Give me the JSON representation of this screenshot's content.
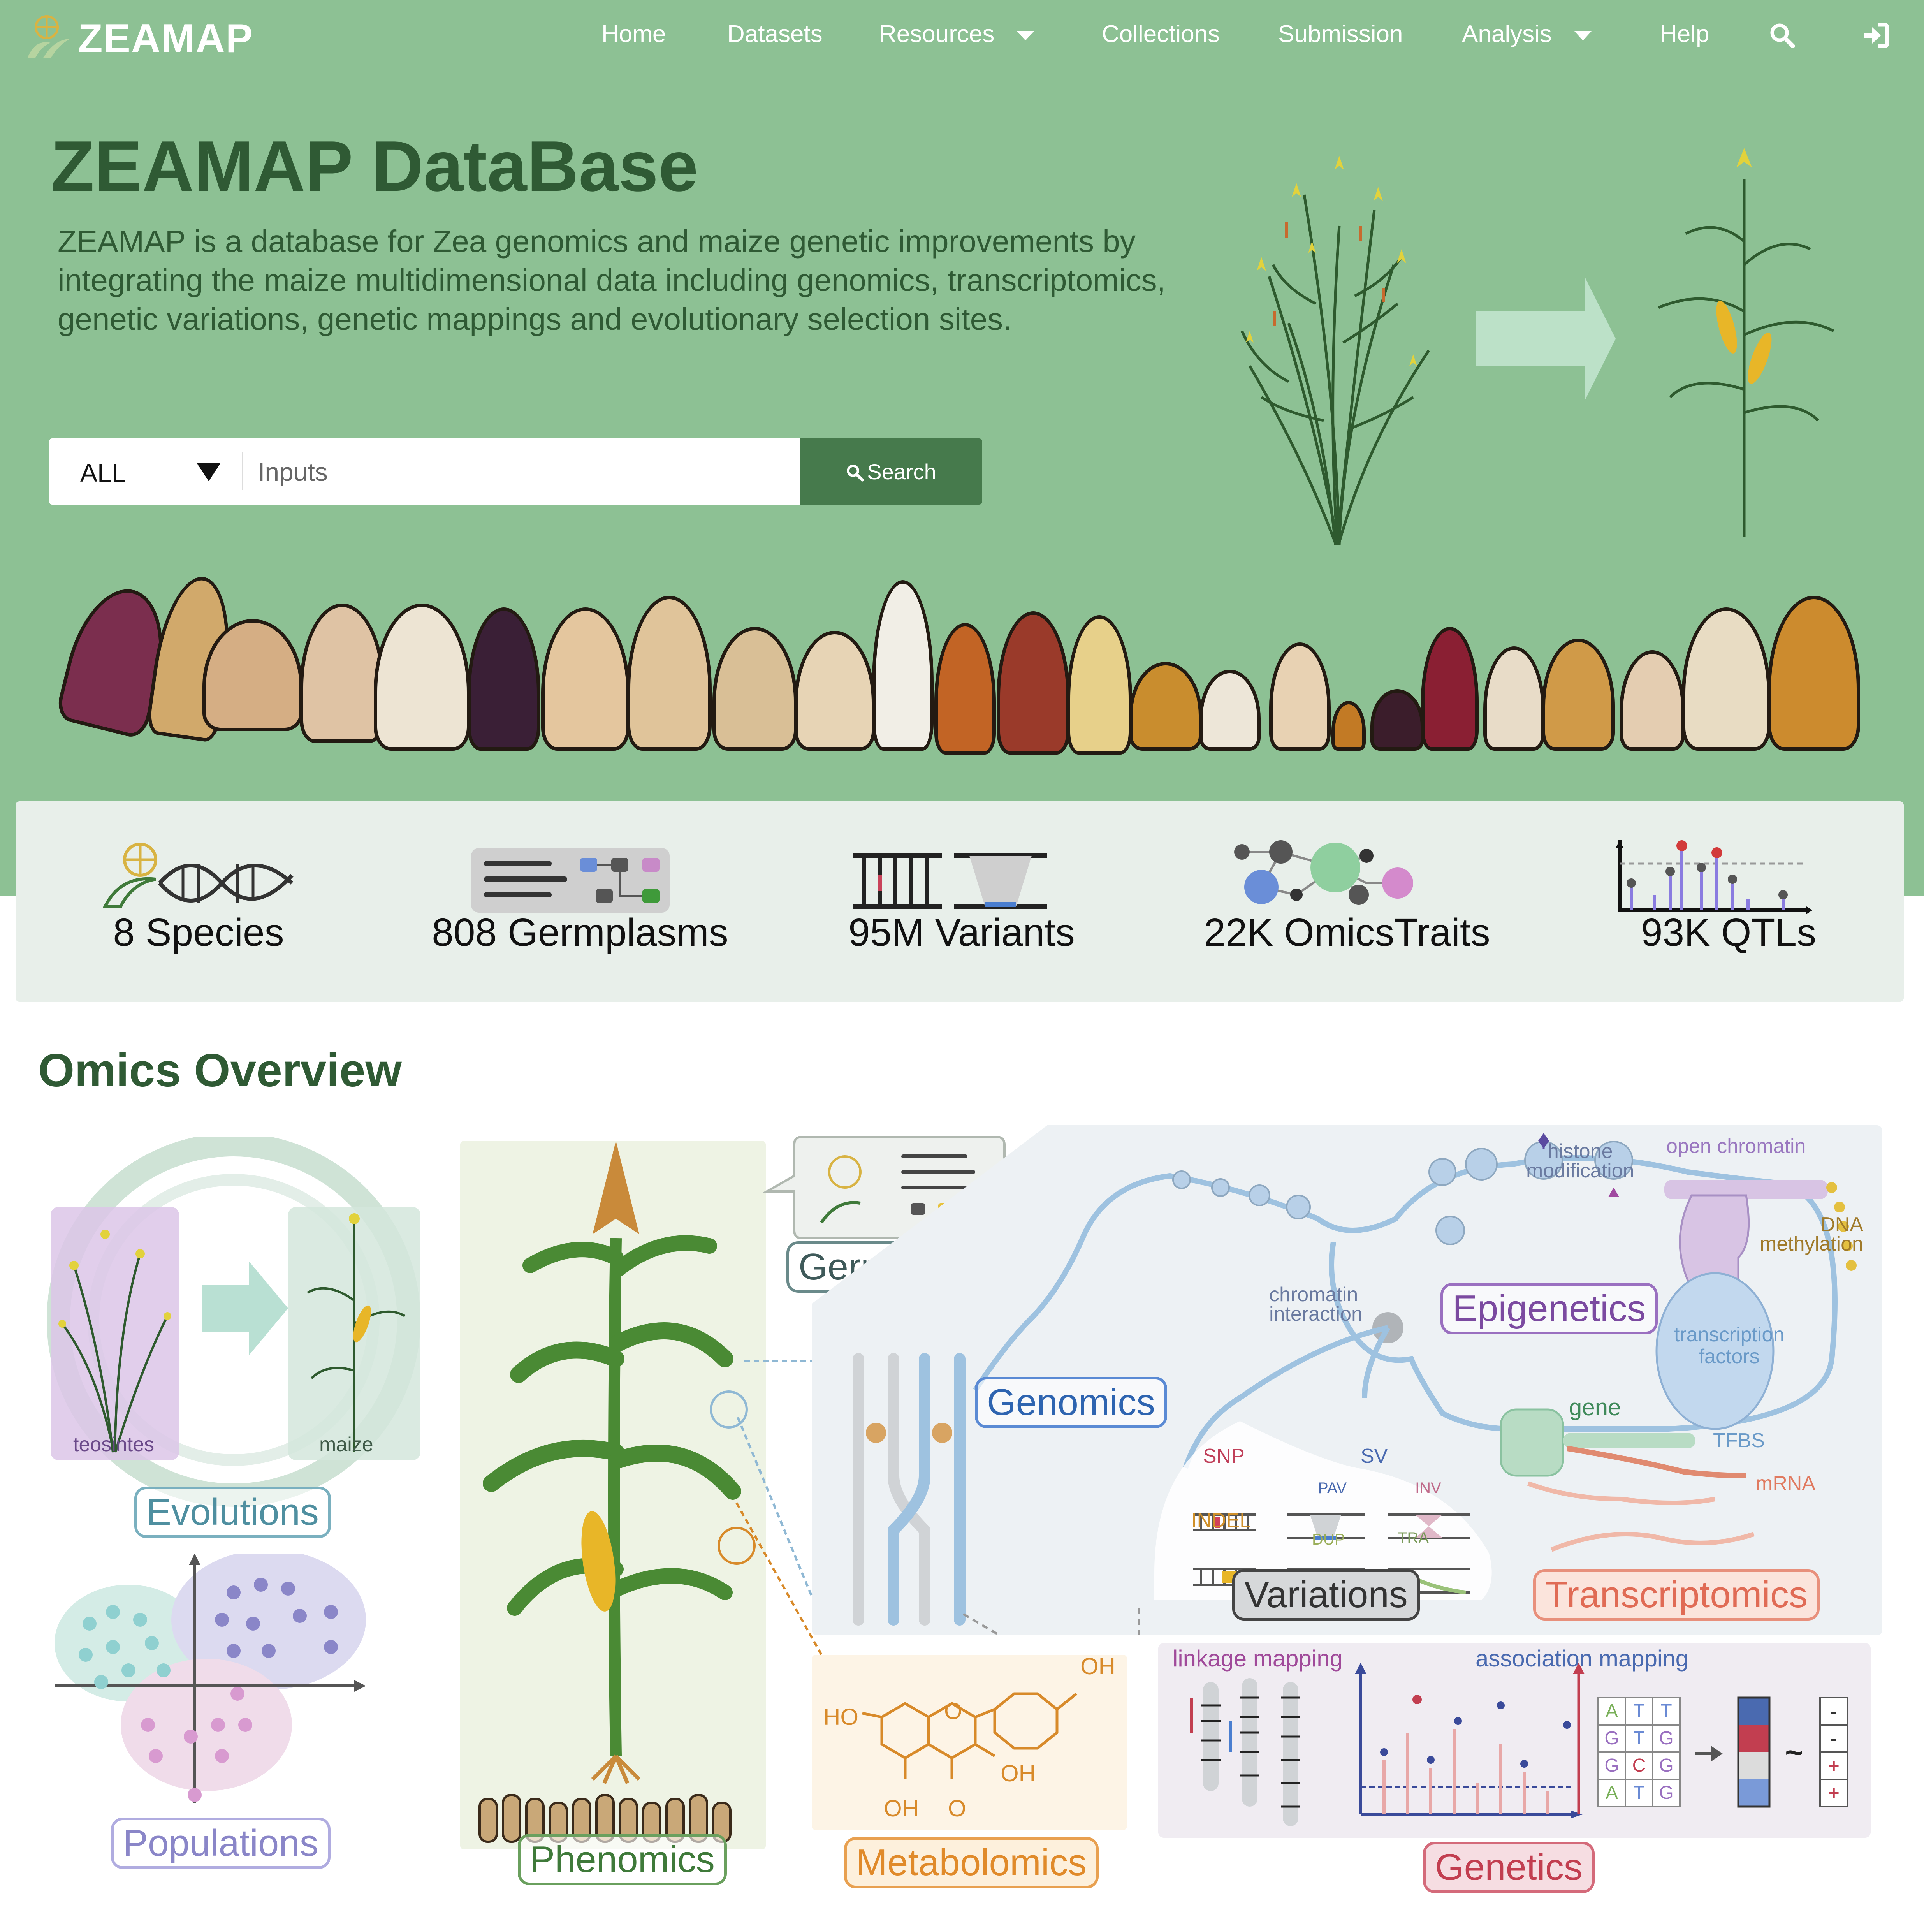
{
  "nav": {
    "brand": "ZEAMAP",
    "items": [
      "Home",
      "Datasets",
      "Resources",
      "Collections",
      "Submission",
      "Analysis",
      "Help"
    ]
  },
  "hero": {
    "title": "ZEAMAP DataBase",
    "description": "ZEAMAP is a database for Zea genomics and maize genetic improvements by integrating the maize multidimensional data including genomics, transcriptomics, genetic variations, genetic mappings and evolutionary selection sites."
  },
  "search": {
    "selected": "ALL",
    "placeholder": "Inputs",
    "button": "Search"
  },
  "stats": [
    "8 Species",
    "808 Germplasms",
    "95M Variants",
    "22K OmicsTraits",
    "93K QTLs"
  ],
  "overview": {
    "title": "Omics Overview",
    "tags": {
      "evolutions": "Evolutions",
      "populations": "Populations",
      "phenomics": "Phenomics",
      "germplasms": "Germplasms",
      "genomics": "Genomics",
      "epigenetics": "Epigenetics",
      "variations": "Variations",
      "transcriptomics": "Transcriptomics",
      "metabolomics": "Metabolomics",
      "genetics": "Genetics"
    },
    "labels": {
      "teosintes": "teosintes",
      "maize": "maize",
      "histone": "histone",
      "modification": "modification",
      "open_chromatin": "open chromatin",
      "dna": "DNA",
      "methylation": "methylation",
      "chromatin": "chromatin",
      "interaction": "interaction",
      "transcription": "transcription",
      "factors": "factors",
      "gene": "gene",
      "tfbs": "TFBS",
      "mrna": "mRNA",
      "snp": "SNP",
      "sv": "SV",
      "pav": "PAV",
      "inv": "INV",
      "indel": "INDEL",
      "dup": "DUP",
      "tra": "TRA",
      "linkage_mapping": "linkage mapping",
      "association_mapping": "association mapping",
      "oh1": "OH",
      "ho": "HO",
      "oh2": "OH",
      "oh3": "OH",
      "o_ring": "O",
      "o_keto": "O"
    },
    "genotype_grid": [
      [
        "A",
        "T",
        "T"
      ],
      [
        "G",
        "T",
        "G"
      ],
      [
        "G",
        "C",
        "G"
      ],
      [
        "A",
        "T",
        "G"
      ]
    ],
    "signs": [
      "-",
      "-",
      "+",
      "+"
    ],
    "tilde": "~"
  },
  "colors": {
    "hero_bg": "#8dc194",
    "title_green": "#2f5a34",
    "search_btn": "#467a4c",
    "genomics": "#2e64b0",
    "epigenetics": "#7b4aa0",
    "transcriptomics": "#e06b55",
    "metabolomics": "#e08a2a",
    "genetics": "#c23e50",
    "populations": "#8a86c8",
    "evolutions": "#4f8fa0",
    "phenomics": "#3f7a3a"
  }
}
